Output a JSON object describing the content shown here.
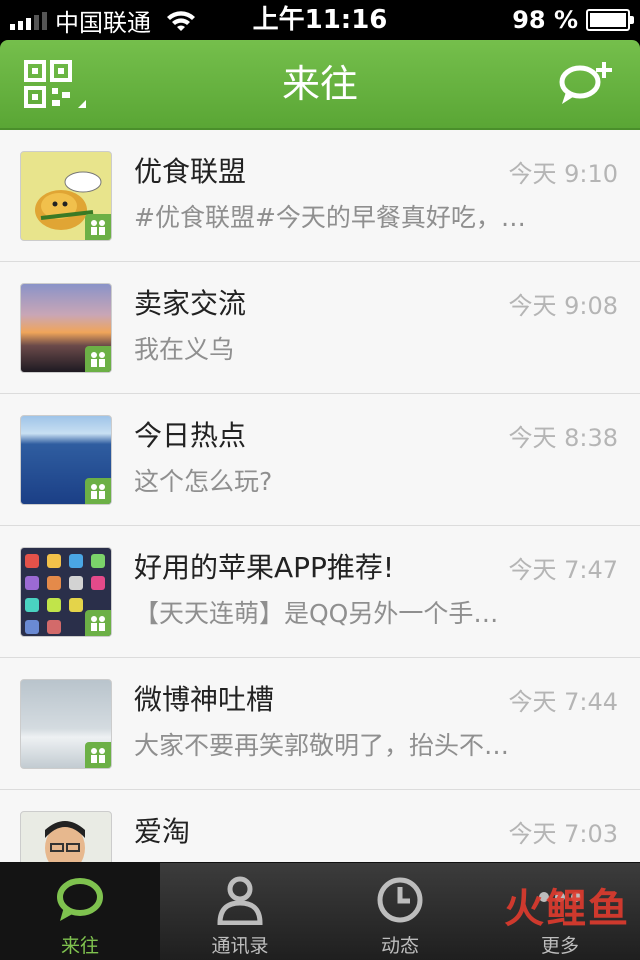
{
  "status_bar": {
    "carrier": "中国联通",
    "time": "上午11:16",
    "battery": "98 %"
  },
  "nav": {
    "title": "来往",
    "left_icon": "qr-code-icon",
    "right_icon": "new-chat-icon"
  },
  "conversations": [
    {
      "name": "优食联盟",
      "time": "今天 9:10",
      "preview": "#优食联盟#今天的早餐真好吃，…",
      "avatar": "mango-cartoon"
    },
    {
      "name": "卖家交流",
      "time": "今天 9:08",
      "preview": "我在义乌",
      "avatar": "sunset"
    },
    {
      "name": "今日热点",
      "time": "今天 8:38",
      "preview": "这个怎么玩?",
      "avatar": "sea"
    },
    {
      "name": "好用的苹果APP推荐!",
      "time": "今天 7:47",
      "preview": "【天天连萌】是QQ另外一个手…",
      "avatar": "app-icons"
    },
    {
      "name": "微博神吐槽",
      "time": "今天 7:44",
      "preview": "大家不要再笑郭敬明了，抬头不…",
      "avatar": "lake"
    },
    {
      "name": "爱淘",
      "time": "今天 7:03",
      "preview": "",
      "avatar": "person"
    }
  ],
  "tabs": [
    {
      "label": "来往",
      "icon": "chat-bubble-icon",
      "active": true
    },
    {
      "label": "通讯录",
      "icon": "contacts-icon",
      "active": false
    },
    {
      "label": "动态",
      "icon": "clock-icon",
      "active": false
    },
    {
      "label": "更多",
      "icon": "more-dots-icon",
      "active": false
    }
  ],
  "watermark": "火鲤鱼",
  "colors": {
    "accent": "#5fab3a",
    "active_tab_label": "#7fc24f"
  }
}
